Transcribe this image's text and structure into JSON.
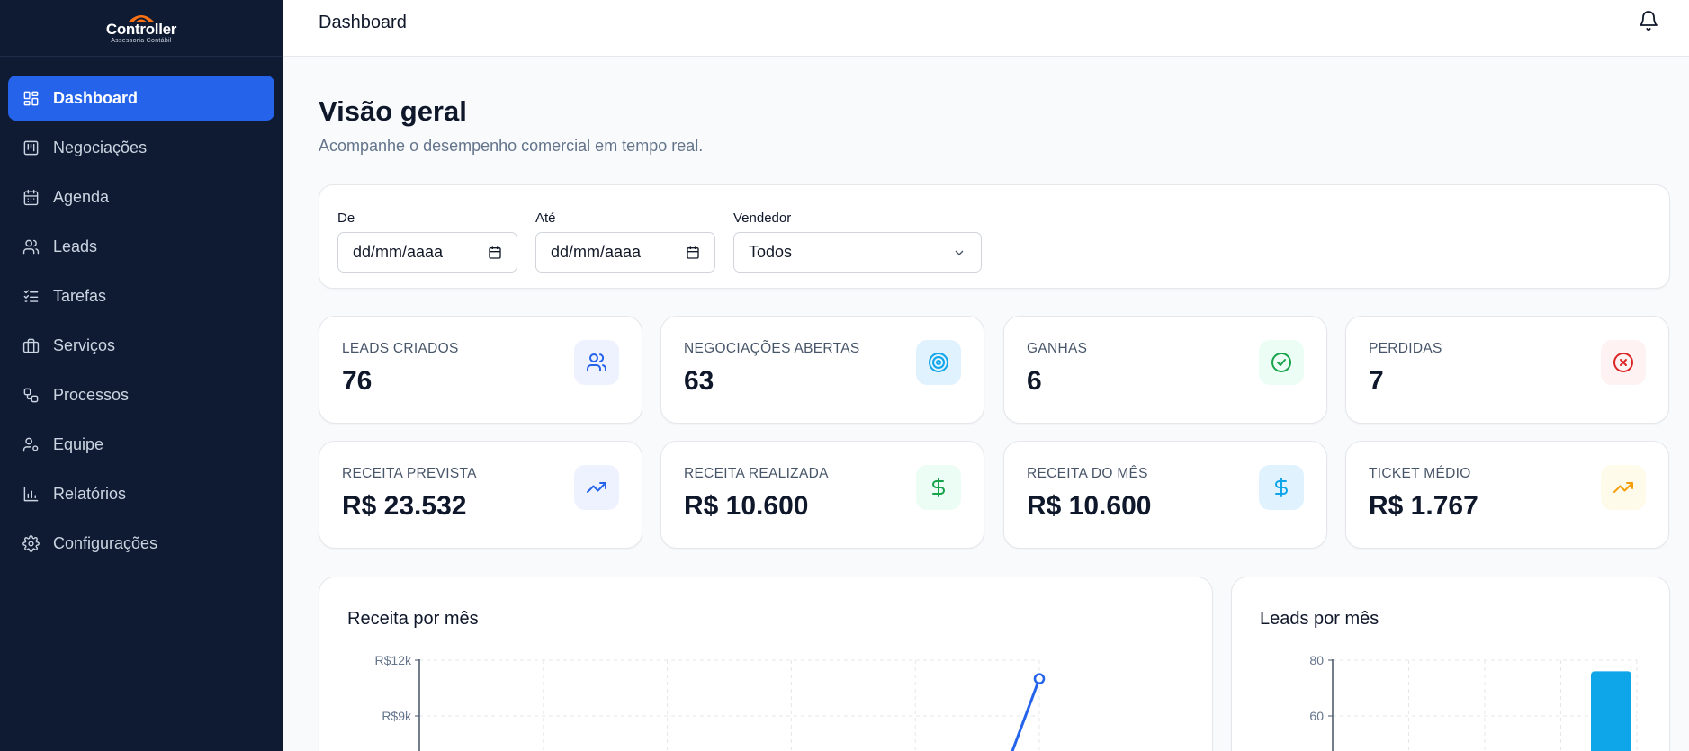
{
  "logo": {
    "name": "Controller",
    "subtitle": "Assessoria Contábil"
  },
  "sidebar": {
    "items": [
      {
        "label": "Dashboard",
        "icon": "dashboard-icon",
        "active": true
      },
      {
        "label": "Negociações",
        "icon": "kanban-icon",
        "active": false
      },
      {
        "label": "Agenda",
        "icon": "calendar-icon",
        "active": false
      },
      {
        "label": "Leads",
        "icon": "users-icon",
        "active": false
      },
      {
        "label": "Tarefas",
        "icon": "checklist-icon",
        "active": false
      },
      {
        "label": "Serviços",
        "icon": "briefcase-icon",
        "active": false
      },
      {
        "label": "Processos",
        "icon": "workflow-icon",
        "active": false
      },
      {
        "label": "Equipe",
        "icon": "user-gear-icon",
        "active": false
      },
      {
        "label": "Relatórios",
        "icon": "bar-chart-icon",
        "active": false
      },
      {
        "label": "Configurações",
        "icon": "gear-icon",
        "active": false
      }
    ]
  },
  "topbar": {
    "title": "Dashboard",
    "icon": "bell-icon"
  },
  "header": {
    "title": "Visão geral",
    "subtitle": "Acompanhe o desempenho comercial em tempo real."
  },
  "filters": {
    "from": {
      "label": "De",
      "value": "dd/mm/aaaa"
    },
    "to": {
      "label": "Até",
      "value": "dd/mm/aaaa"
    },
    "seller": {
      "label": "Vendedor",
      "value": "Todos"
    }
  },
  "stats": [
    {
      "label": "LEADS CRIADOS",
      "value": "76",
      "icon": "users-icon",
      "color": "#2563eb",
      "bg": "#eef2ff"
    },
    {
      "label": "NEGOCIAÇÕES ABERTAS",
      "value": "63",
      "icon": "target-icon",
      "color": "#0ea5e9",
      "bg": "#e0f2fe"
    },
    {
      "label": "GANHAS",
      "value": "6",
      "icon": "check-circle-icon",
      "color": "#16a34a",
      "bg": "#ecfdf5"
    },
    {
      "label": "PERDIDAS",
      "value": "7",
      "icon": "x-circle-icon",
      "color": "#dc2626",
      "bg": "#fef2f2"
    },
    {
      "label": "RECEITA PREVISTA",
      "value": "R$ 23.532",
      "icon": "trending-up-icon",
      "color": "#2563eb",
      "bg": "#eef2ff"
    },
    {
      "label": "RECEITA REALIZADA",
      "value": "R$ 10.600",
      "icon": "dollar-icon",
      "color": "#16a34a",
      "bg": "#ecfdf5"
    },
    {
      "label": "RECEITA DO MÊS",
      "value": "R$ 10.600",
      "icon": "dollar-icon",
      "color": "#0ea5e9",
      "bg": "#e0f2fe"
    },
    {
      "label": "TICKET MÉDIO",
      "value": "R$ 1.767",
      "icon": "trending-up-icon",
      "color": "#f59e0b",
      "bg": "#fffbeb"
    }
  ],
  "chart_data": [
    {
      "type": "line",
      "title": "Receita por mês",
      "y_ticks": [
        "R$12k",
        "R$9k"
      ],
      "ylim": [
        0,
        12000
      ],
      "points": [
        {
          "index": 5,
          "value": 11000
        }
      ],
      "color": "#2563eb",
      "grid": true
    },
    {
      "type": "bar",
      "title": "Leads por mês",
      "y_ticks": [
        "80",
        "60"
      ],
      "ylim": [
        0,
        80
      ],
      "values": [
        76
      ],
      "color": "#0ea5e9",
      "grid": true
    }
  ]
}
